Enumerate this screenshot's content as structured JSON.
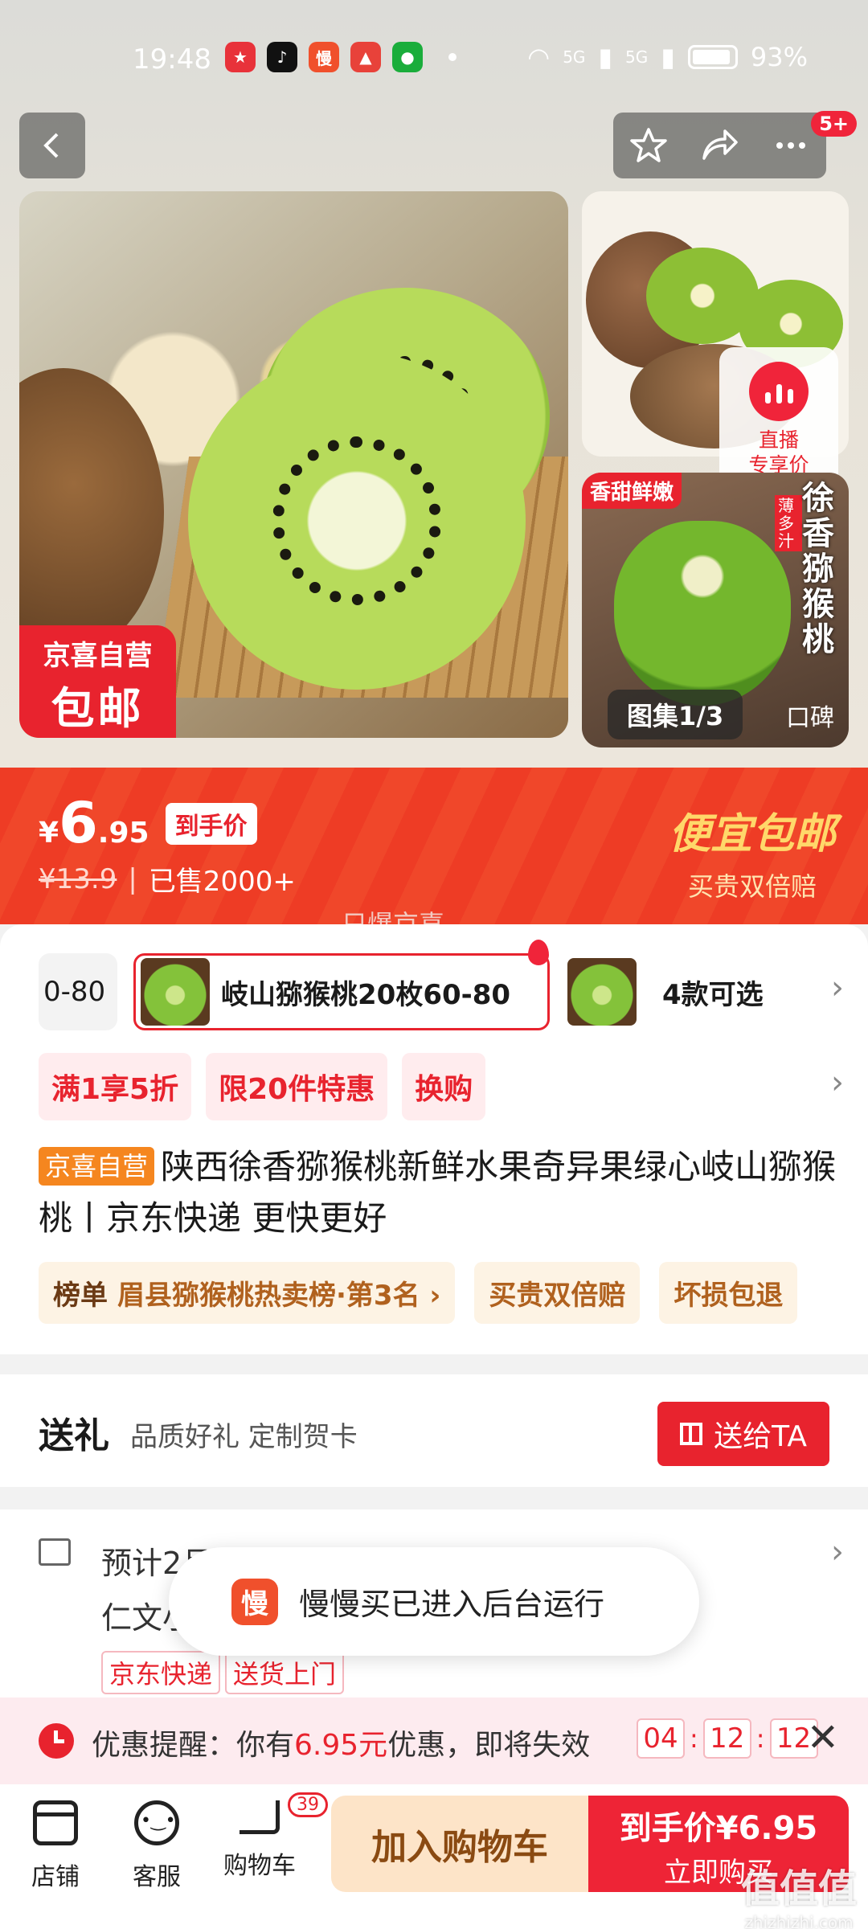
{
  "status_bar": {
    "time": "19:48",
    "net1": "5G",
    "net2": "5G",
    "battery": "93%",
    "apps": [
      {
        "name": "app-icon-1",
        "glyph": "★",
        "color": "#e8323a"
      },
      {
        "name": "douyin-icon",
        "glyph": "♪",
        "color": "#111111"
      },
      {
        "name": "manman-icon",
        "glyph": "慢",
        "color": "#f0502c"
      },
      {
        "name": "app-icon-4",
        "glyph": "▲",
        "color": "#e8423a"
      },
      {
        "name": "app-icon-5",
        "glyph": "●",
        "color": "#1aad3b"
      }
    ]
  },
  "nav": {
    "back_icon": "chevron-left-icon",
    "star_icon": "star-icon",
    "share_icon": "share-icon",
    "more_icon": "more-icon",
    "badge": "5+"
  },
  "gallery": {
    "promo_tag_line1": "京喜自营",
    "promo_tag_line2": "包邮",
    "thumb_tag": "香甜鲜嫩",
    "thumb_small_text": "薄多汁",
    "thumb_vertical_text": "徐香猕猴桃",
    "count": "图集1/3",
    "review_tab": "口碑",
    "live_line1": "直播",
    "live_line2": "专享价"
  },
  "price": {
    "currency": "¥",
    "integer": "6",
    "decimal": ".95",
    "label": "到手价",
    "old_price": "¥13.9",
    "separator": "|",
    "sold": "已售2000+",
    "promo_big": "便宜包邮",
    "promo_small": "买贵双倍赔",
    "explosive": "只爆京喜"
  },
  "sku": {
    "cut_label": "0-80",
    "selected_label": "岐山猕猴桃20枚60-80",
    "more_label": "4款可选"
  },
  "coupons": [
    "满1享5折",
    "限20件特惠",
    "换购"
  ],
  "title": {
    "shop_tag": "京喜自营",
    "text": "陕西徐香猕猴桃新鲜水果奇异果绿心岐山猕猴桃丨京东快递 更快更好"
  },
  "rank": {
    "label": "榜单",
    "text": "眉县猕猴桃热卖榜·第3名 ›",
    "chip2": "买贵双倍赔",
    "chip3": "坏损包退"
  },
  "gift": {
    "title": "送礼",
    "subtitle": "品质好礼 定制贺卡",
    "button": "送给TA"
  },
  "delivery": {
    "line1": "预计2月16日24:00前发货",
    "line2": "仁文小区附近",
    "tags": [
      "京东快递",
      "送货上门"
    ]
  },
  "toast": {
    "icon_glyph": "慢",
    "text": "慢慢买已进入后台运行"
  },
  "reminder": {
    "prefix": "优惠提醒：你有",
    "amount": "6.95元",
    "suffix": "优惠，即将失效",
    "hh": "04",
    "mm": "12",
    "ss": "12"
  },
  "bottom": {
    "shop": "店铺",
    "service": "客服",
    "cart": "购物车",
    "cart_count": "39",
    "add_cart": "加入购物车",
    "buy_line1": "到手价¥6.95",
    "buy_line2": "立即购买"
  },
  "watermark": {
    "main": "值值值",
    "sub": "zhizhizhi.com"
  },
  "colors": {
    "accent": "#e8232e",
    "banner": "#f0472a",
    "cart_button": "#fde4c8"
  }
}
